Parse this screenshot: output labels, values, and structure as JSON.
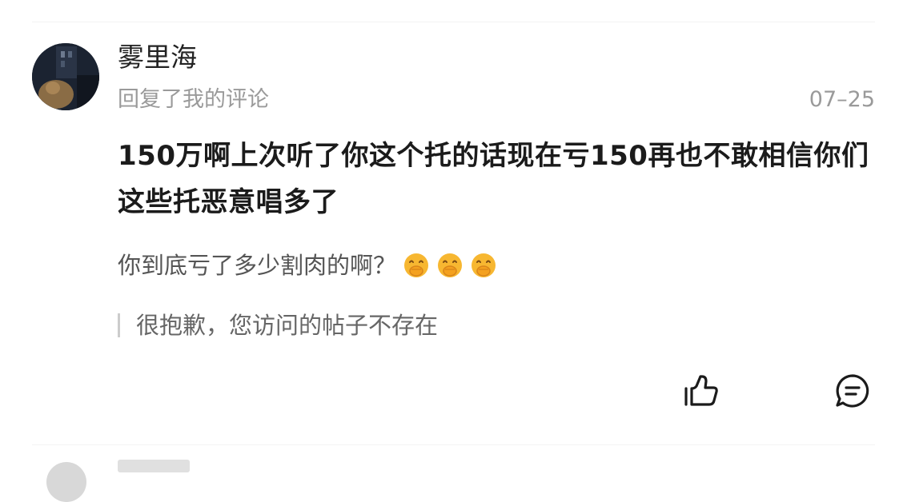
{
  "comment": {
    "username": "雾里海",
    "subtitle": "回复了我的评论",
    "date": "07–25",
    "text": "150万啊上次听了你这个托的话现在亏150再也不敢相信你们这些托恶意唱多了",
    "quoted_text": "你到底亏了多少割肉的啊？",
    "quoted_emojis": [
      "covering-mouth-emoji",
      "covering-mouth-emoji",
      "covering-mouth-emoji"
    ],
    "notice": "很抱歉，您访问的帖子不存在"
  },
  "actions": {
    "like_icon": "thumbs-up-icon",
    "reply_icon": "comment-bubble-icon"
  },
  "colors": {
    "username": "#222222",
    "secondary_text": "#9a9a9a",
    "comment_text": "#1b1b1b",
    "emoji_yellow": "#f7b731"
  }
}
